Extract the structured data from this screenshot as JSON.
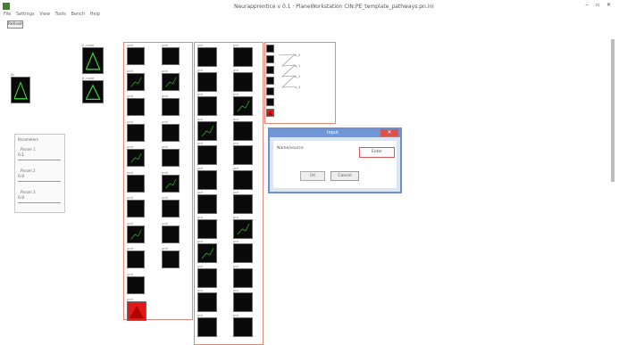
{
  "window": {
    "title": "Neurapprentice v 0.1  ·  PlaneWorkstation CIN:PE_template_pathways.pn.ini",
    "controls": "‒ ▫ ✕"
  },
  "menu": [
    "File",
    "Settings",
    "View",
    "Tools",
    "Bench",
    "Help"
  ],
  "toolbar": {
    "refresh_label": "Refresh"
  },
  "params": {
    "title": "Parameters",
    "fields": [
      {
        "label": "Param 1",
        "value": "0.1"
      },
      {
        "label": "Param 2",
        "value": "0.0"
      },
      {
        "label": "Param 3",
        "value": "0.0"
      }
    ]
  },
  "dialog": {
    "title": "Input",
    "prompt": "Name/source",
    "action_label": "Enter",
    "ok_label": "OK",
    "cancel_label": "Cancel",
    "close_glyph": "✕"
  },
  "tiles": [
    {
      "label": "IN",
      "style": "green"
    },
    {
      "label": "A_node",
      "style": "green"
    },
    {
      "label": "B_node",
      "style": "green"
    },
    {
      "label": "unit",
      "style": "dark"
    },
    {
      "label": "unit",
      "style": "trace"
    },
    {
      "label": "unit",
      "style": "dark"
    },
    {
      "label": "unit",
      "style": "red"
    },
    {
      "label": "out",
      "style": "dark"
    },
    {
      "label": "out",
      "style": "trace"
    }
  ],
  "legend_items": [
    "a_0",
    "a_1",
    "a_2",
    "a_3"
  ],
  "colors": {
    "accent_box": "#e08a7a",
    "dialog_frame": "#6f8fcf",
    "tile_green": "#3ddc3d",
    "tile_red": "#e01818"
  }
}
